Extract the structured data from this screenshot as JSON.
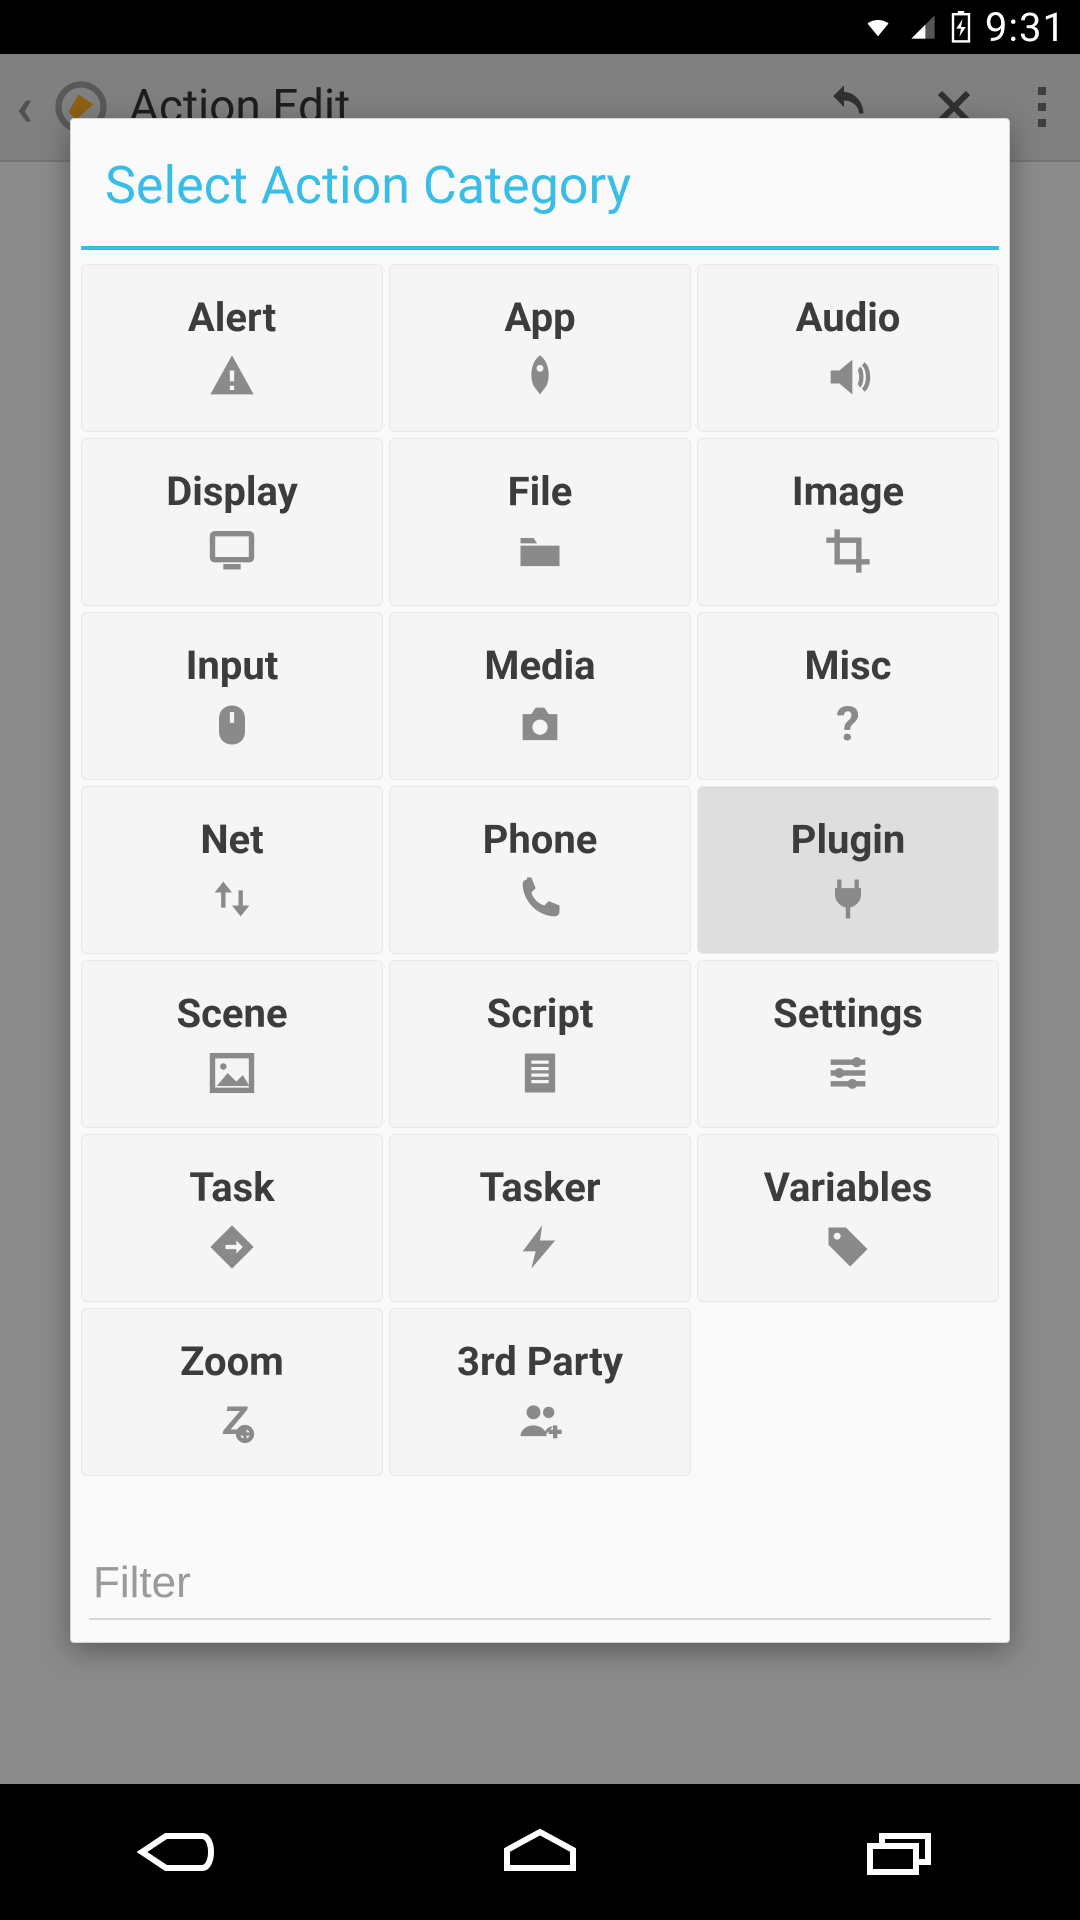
{
  "statusbar": {
    "time": "9:31"
  },
  "actionbar": {
    "title": "Action Edit"
  },
  "dialog": {
    "title": "Select Action Category",
    "filter_placeholder": "Filter",
    "selected_index": 11,
    "categories": [
      {
        "label": "Alert",
        "icon": "alert-icon"
      },
      {
        "label": "App",
        "icon": "rocket-icon"
      },
      {
        "label": "Audio",
        "icon": "speaker-icon"
      },
      {
        "label": "Display",
        "icon": "monitor-icon"
      },
      {
        "label": "File",
        "icon": "folder-icon"
      },
      {
        "label": "Image",
        "icon": "crop-icon"
      },
      {
        "label": "Input",
        "icon": "mouse-icon"
      },
      {
        "label": "Media",
        "icon": "camera-icon"
      },
      {
        "label": "Misc",
        "icon": "question-icon"
      },
      {
        "label": "Net",
        "icon": "updown-icon"
      },
      {
        "label": "Phone",
        "icon": "phone-icon"
      },
      {
        "label": "Plugin",
        "icon": "plug-icon"
      },
      {
        "label": "Scene",
        "icon": "picture-icon"
      },
      {
        "label": "Script",
        "icon": "document-icon"
      },
      {
        "label": "Settings",
        "icon": "sliders-icon"
      },
      {
        "label": "Task",
        "icon": "directions-icon"
      },
      {
        "label": "Tasker",
        "icon": "lightning-icon"
      },
      {
        "label": "Variables",
        "icon": "tag-icon"
      },
      {
        "label": "Zoom",
        "icon": "zoom-icon"
      },
      {
        "label": "3rd Party",
        "icon": "group-add-icon"
      }
    ]
  }
}
